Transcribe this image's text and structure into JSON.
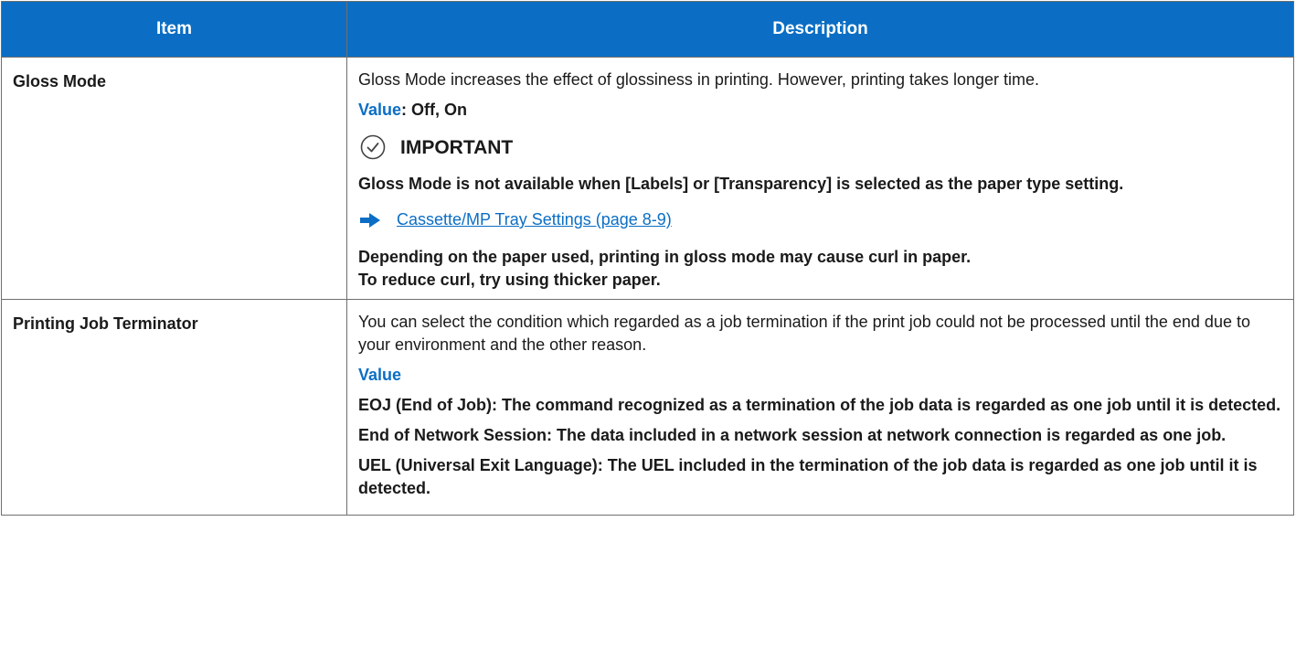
{
  "header": {
    "item": "Item",
    "description": "Description"
  },
  "rows": [
    {
      "item": "Gloss Mode",
      "intro": "Gloss Mode increases the effect of glossiness in printing. However, printing takes longer time.",
      "value_label": "Value",
      "value_text": ": Off, On",
      "important_label": "IMPORTANT",
      "important_text": "Gloss Mode is not available when [Labels] or [Transparency] is selected as the paper type setting.",
      "link_text": "Cassette/MP Tray Settings (page 8-9)",
      "note_line1": "Depending on the paper used, printing in gloss mode may cause curl in paper.",
      "note_line2": "To reduce curl, try using thicker paper."
    },
    {
      "item": "Printing Job Terminator",
      "intro": "You can select the condition which regarded as a job termination if the print job could not be processed until the end due to your environment and the other reason.",
      "value_label": "Value",
      "options": [
        "EOJ (End of Job): The command recognized as a termination of the job data is regarded as one job until it is detected.",
        "End of Network Session: The data included in a network session at network connection is regarded as one job.",
        "UEL (Universal Exit Language): The UEL included in the termination of the job data is regarded as one job until it is detected."
      ]
    }
  ],
  "colors": {
    "header_bg": "#0b6ec4",
    "accent": "#0b6ec4",
    "border": "#6f6f6f"
  },
  "icons": {
    "important": "check-circle-icon",
    "link": "arrow-right-icon"
  }
}
